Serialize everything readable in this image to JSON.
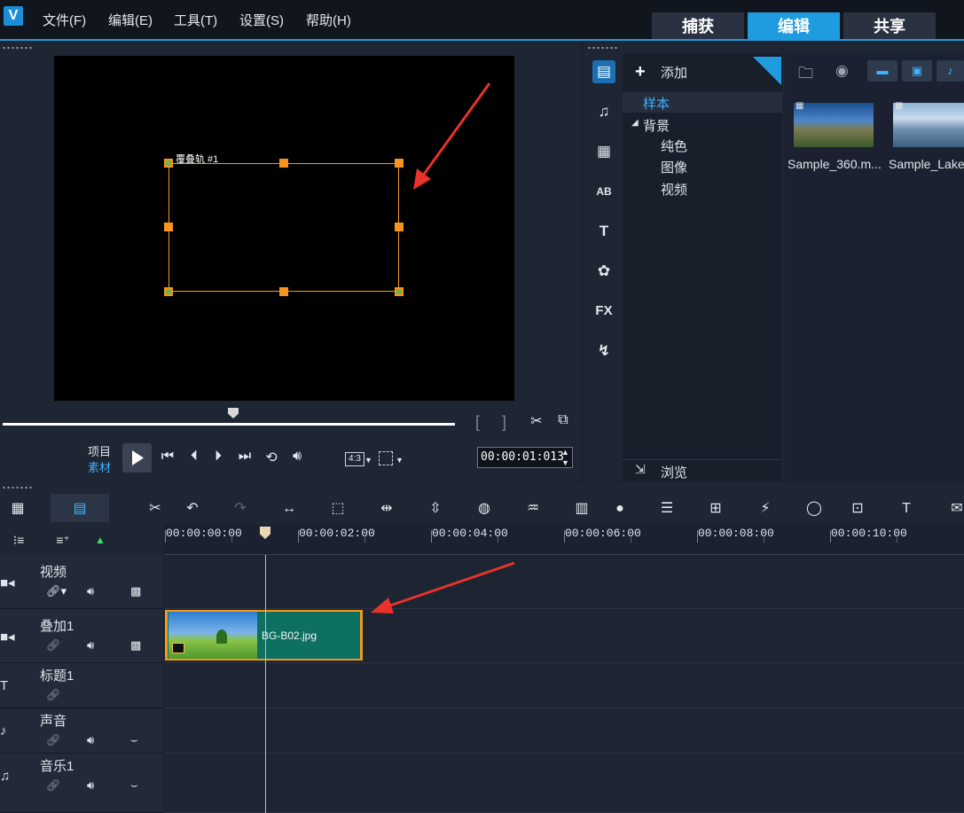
{
  "menu": {
    "logo": "V",
    "items": [
      "文件(F)",
      "编辑(E)",
      "工具(T)",
      "设置(S)",
      "帮助(H)"
    ]
  },
  "mode_tabs": [
    "捕获",
    "编辑",
    "共享"
  ],
  "preview": {
    "overlay_label": "覆叠轨 #1",
    "mode_project": "项目",
    "mode_clip": "素材",
    "timecode": "00:00:01:013",
    "aspect": "4:3"
  },
  "library": {
    "add_label": "添加",
    "tree": {
      "sample": "样本",
      "background": "背景",
      "solid_color": "纯色",
      "image": "图像",
      "video": "视频"
    },
    "browse_label": "浏览",
    "fx_label": "FX",
    "thumbs": [
      "Sample_360.m...",
      "Sample_Lake"
    ]
  },
  "timeline": {
    "ruler": [
      "00:00:00:00",
      "00:00:02:00",
      "00:00:04:00",
      "00:00:06:00",
      "00:00:08:00",
      "00:00:10:00"
    ],
    "tracks": {
      "video": "视频",
      "overlay": "叠加1",
      "title": "标题1",
      "voice": "声音",
      "music": "音乐1"
    },
    "clip_name": "BG-B02.jpg"
  }
}
